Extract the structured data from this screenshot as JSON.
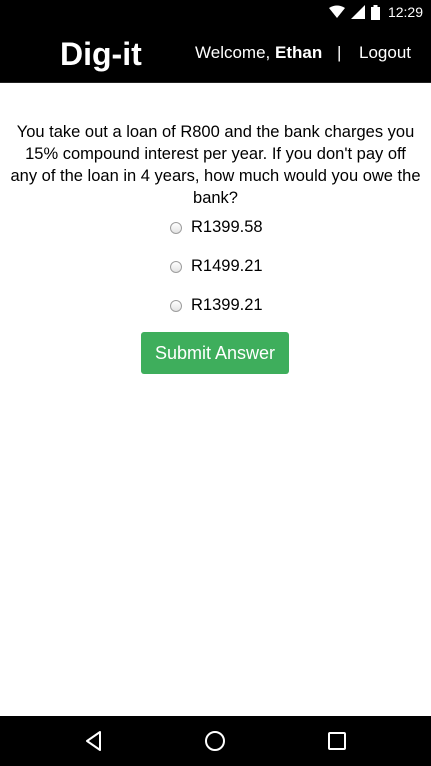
{
  "status_bar": {
    "time": "12:29",
    "icons": [
      "wifi-icon",
      "signal-icon",
      "battery-icon"
    ]
  },
  "header": {
    "brand": "Dig-it",
    "welcome_prefix": "Welcome, ",
    "user_name": "Ethan",
    "divider": "|",
    "logout_label": "Logout"
  },
  "question": {
    "text": "You take out a loan of R800 and the bank charges you 15% compound interest per year. If you don't pay off any of the loan in 4 years, how much would you owe the bank?",
    "options": [
      {
        "label": "R1399.58"
      },
      {
        "label": "R1499.21"
      },
      {
        "label": "R1399.21"
      }
    ],
    "submit_label": "Submit Answer"
  },
  "nav_bar": {
    "icons": [
      "back-icon",
      "home-icon",
      "recents-icon"
    ]
  },
  "colors": {
    "header_bg": "#000000",
    "submit_bg": "#3eae5c",
    "text": "#000000"
  }
}
